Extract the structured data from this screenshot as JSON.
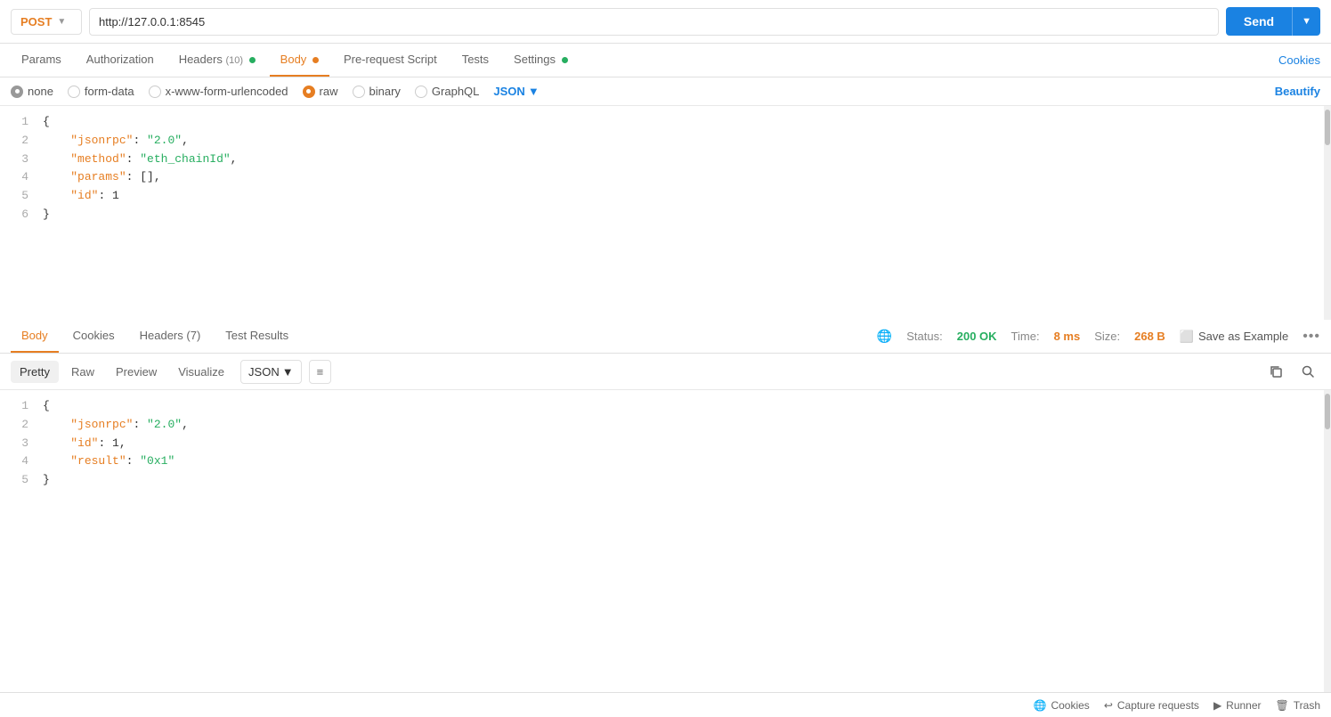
{
  "url_bar": {
    "method": "POST",
    "url": "http://127.0.0.1:8545",
    "send_label": "Send"
  },
  "request_tabs": {
    "params_label": "Params",
    "auth_label": "Authorization",
    "headers_label": "Headers",
    "headers_count": "10",
    "body_label": "Body",
    "prerequest_label": "Pre-request Script",
    "tests_label": "Tests",
    "settings_label": "Settings",
    "cookies_label": "Cookies"
  },
  "body_types": {
    "none_label": "none",
    "form_data_label": "form-data",
    "url_encoded_label": "x-www-form-urlencoded",
    "raw_label": "raw",
    "binary_label": "binary",
    "graphql_label": "GraphQL",
    "json_label": "JSON",
    "beautify_label": "Beautify"
  },
  "request_body": {
    "lines": [
      "1",
      "2",
      "3",
      "4",
      "5",
      "6"
    ],
    "content": [
      "{",
      "    \"jsonrpc\": \"2.0\",",
      "    \"method\": \"eth_chainId\",",
      "    \"params\": [],",
      "    \"id\": 1",
      "}"
    ]
  },
  "response_tabs": {
    "body_label": "Body",
    "cookies_label": "Cookies",
    "headers_label": "Headers",
    "headers_count": "7",
    "test_results_label": "Test Results"
  },
  "response_status": {
    "status_label": "Status:",
    "status_value": "200 OK",
    "time_label": "Time:",
    "time_value": "8 ms",
    "size_label": "Size:",
    "size_value": "268 B",
    "save_label": "Save as Example"
  },
  "response_format": {
    "pretty_label": "Pretty",
    "raw_label": "Raw",
    "preview_label": "Preview",
    "visualize_label": "Visualize",
    "json_label": "JSON"
  },
  "response_body": {
    "lines": [
      "1",
      "2",
      "3",
      "4",
      "5"
    ],
    "content": [
      "{",
      "    \"jsonrpc\": \"2.0\",",
      "    \"id\": 1,",
      "    \"result\": \"0x1\"",
      "}"
    ]
  },
  "status_bar": {
    "cookies_label": "Cookies",
    "capture_label": "Capture requests",
    "runner_label": "Runner",
    "trash_label": "Trash"
  },
  "colors": {
    "active_tab": "#e67e22",
    "link": "#1a82e2",
    "send_btn": "#1a82e2",
    "status_ok": "#27ae60",
    "key_color": "#e67e22",
    "string_color": "#27ae60"
  }
}
